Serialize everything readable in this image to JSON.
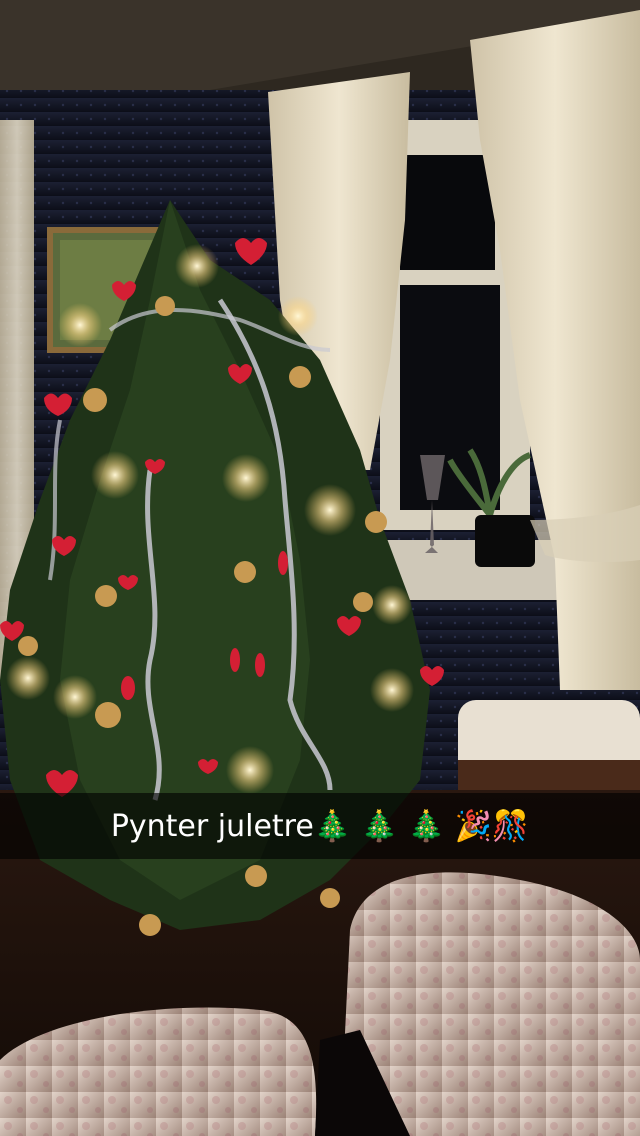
{
  "caption": {
    "text": "Pynter juletre🎄 🎄 🎄 🎉🎊"
  },
  "scene": {
    "colors": {
      "wall": "#14182b",
      "curtain": "#e6dcc4",
      "tree": "#1f3318",
      "light": "#fff1b8",
      "ornament_red": "#d41f34",
      "ornament_gold": "#c89a52",
      "armchair": "#d8c7bd"
    }
  }
}
